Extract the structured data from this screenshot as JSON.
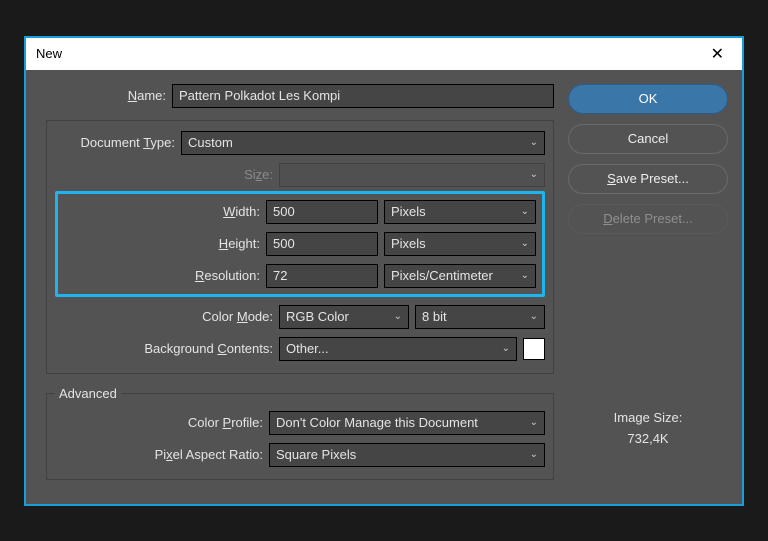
{
  "window": {
    "title": "New"
  },
  "name": {
    "label": "Name:",
    "value": "Pattern Polkadot Les Kompi"
  },
  "docType": {
    "label": "Document Type:",
    "value": "Custom"
  },
  "size": {
    "label": "Size:",
    "value": ""
  },
  "width": {
    "label": "Width:",
    "value": "500",
    "unit": "Pixels"
  },
  "height": {
    "label": "Height:",
    "value": "500",
    "unit": "Pixels"
  },
  "resolution": {
    "label": "Resolution:",
    "value": "72",
    "unit": "Pixels/Centimeter"
  },
  "colorMode": {
    "label": "Color Mode:",
    "mode": "RGB Color",
    "depth": "8 bit"
  },
  "bgContents": {
    "label": "Background Contents:",
    "value": "Other..."
  },
  "advanced": {
    "legend": "Advanced",
    "colorProfile": {
      "label": "Color Profile:",
      "value": "Don't Color Manage this Document"
    },
    "pixelAspect": {
      "label": "Pixel Aspect Ratio:",
      "value": "Square Pixels"
    }
  },
  "buttons": {
    "ok": "OK",
    "cancel": "Cancel",
    "savePreset": "Save Preset...",
    "deletePreset": "Delete Preset..."
  },
  "imageSize": {
    "label": "Image Size:",
    "value": "732,4K"
  }
}
